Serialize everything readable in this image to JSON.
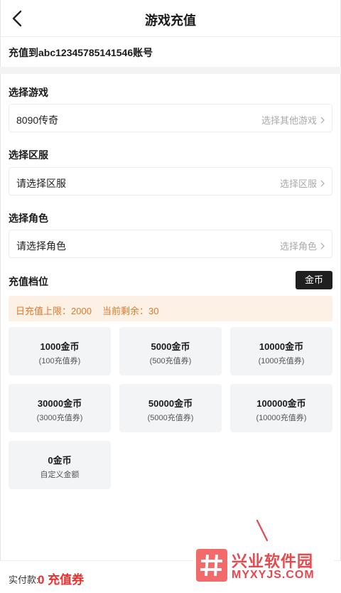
{
  "header": {
    "title": "游戏充值"
  },
  "account": {
    "text": "充值到abc12345785141546账号"
  },
  "game": {
    "label": "选择游戏",
    "value": "8090传奇",
    "action": "选择其他游戏"
  },
  "server": {
    "label": "选择区服",
    "value": "请选择区服",
    "action": "选择区服"
  },
  "role": {
    "label": "选择角色",
    "value": "请选择角色",
    "action": "选择角色"
  },
  "recharge": {
    "label": "充值档位",
    "currency_badge": "金币",
    "daily_limit": "日充值上限：2000",
    "remaining": "当前剩余：30",
    "packages": [
      {
        "main": "1000金币",
        "sub": "(100充值券)"
      },
      {
        "main": "5000金币",
        "sub": "(500充值券)"
      },
      {
        "main": "10000金币",
        "sub": "(1000充值券)"
      },
      {
        "main": "30000金币",
        "sub": "(3000充值券)"
      },
      {
        "main": "50000金币",
        "sub": "(5000充值券)"
      },
      {
        "main": "100000金币",
        "sub": "(10000充值券)"
      },
      {
        "main": "0金币",
        "sub": "自定义金额"
      }
    ]
  },
  "footer": {
    "pay_label": "实付款:",
    "pay_value": "0 充值券"
  },
  "watermark": {
    "title": "兴业软件园",
    "subtitle": "MYXYJS.COM"
  },
  "colors": {
    "accent_red": "#ee2d2d",
    "limit_bg": "#fdf1e6",
    "limit_text": "#e07a2a",
    "badge_bg": "#1f1f1f"
  },
  "icons": {
    "back": "chevron-left-icon",
    "row_arrow": "chevron-right-icon",
    "watermark_logo": "hash-logo-icon"
  }
}
